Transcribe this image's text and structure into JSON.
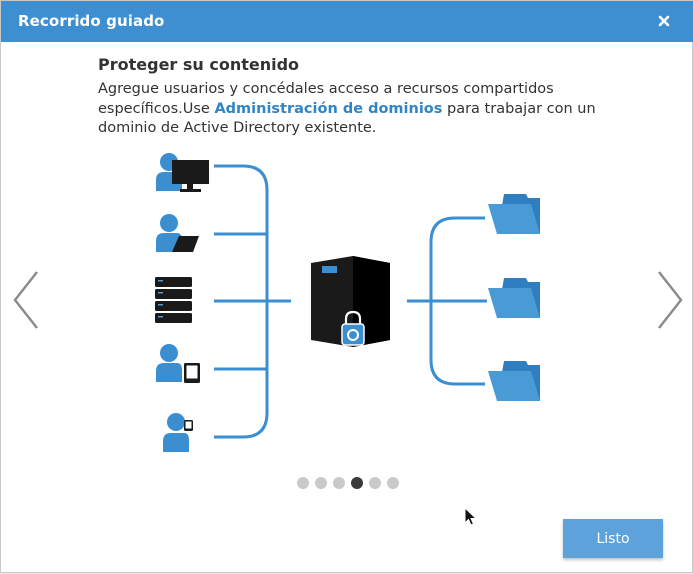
{
  "dialog": {
    "title": "Recorrido guiado",
    "close_icon": "close-icon"
  },
  "content": {
    "heading": "Proteger su contenido",
    "desc_before": "Agregue usuarios y concédales acceso a recursos compartidos específicos.Use ",
    "desc_link": "Administración de dominios",
    "desc_after": " para trabajar con un dominio de Active Directory existente."
  },
  "navigation": {
    "prev_icon": "chevron-left-icon",
    "next_icon": "chevron-right-icon"
  },
  "pagination": {
    "total": 6,
    "active_index": 3
  },
  "footer": {
    "done_label": "Listo"
  },
  "colors": {
    "titlebar": "#3d8fd1",
    "accent": "#3b8ed0",
    "link": "#2f85c8",
    "server": "#1a1a1a",
    "button": "#5ea2dc"
  }
}
